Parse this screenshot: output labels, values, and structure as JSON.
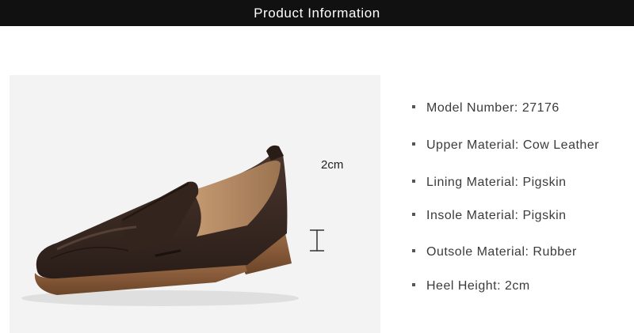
{
  "header": {
    "title": "Product Information"
  },
  "photo": {
    "heel_label": "2cm"
  },
  "specs": [
    {
      "text": "Model Number: 27176"
    },
    {
      "text": "Upper Material: Cow Leather"
    },
    {
      "text": "Lining Material: Pigskin"
    },
    {
      "text": "Insole Material: Pigskin"
    },
    {
      "text": "Outsole Material: Rubber"
    },
    {
      "text": "Heel Height: 2cm"
    }
  ],
  "colors": {
    "header_bg": "#111111",
    "leather": "#3a2a24",
    "sole": "#8a5a3a",
    "lining": "#b08560"
  }
}
